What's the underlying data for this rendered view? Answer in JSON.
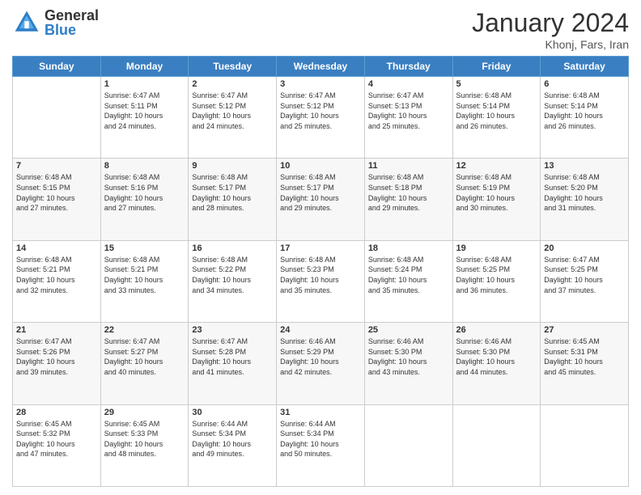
{
  "header": {
    "logo": {
      "general": "General",
      "blue": "Blue"
    },
    "title": "January 2024",
    "location": "Khonj, Fars, Iran"
  },
  "weekdays": [
    "Sunday",
    "Monday",
    "Tuesday",
    "Wednesday",
    "Thursday",
    "Friday",
    "Saturday"
  ],
  "weeks": [
    [
      {
        "day": "",
        "info": ""
      },
      {
        "day": "1",
        "info": "Sunrise: 6:47 AM\nSunset: 5:11 PM\nDaylight: 10 hours\nand 24 minutes."
      },
      {
        "day": "2",
        "info": "Sunrise: 6:47 AM\nSunset: 5:12 PM\nDaylight: 10 hours\nand 24 minutes."
      },
      {
        "day": "3",
        "info": "Sunrise: 6:47 AM\nSunset: 5:12 PM\nDaylight: 10 hours\nand 25 minutes."
      },
      {
        "day": "4",
        "info": "Sunrise: 6:47 AM\nSunset: 5:13 PM\nDaylight: 10 hours\nand 25 minutes."
      },
      {
        "day": "5",
        "info": "Sunrise: 6:48 AM\nSunset: 5:14 PM\nDaylight: 10 hours\nand 26 minutes."
      },
      {
        "day": "6",
        "info": "Sunrise: 6:48 AM\nSunset: 5:14 PM\nDaylight: 10 hours\nand 26 minutes."
      }
    ],
    [
      {
        "day": "7",
        "info": "Sunrise: 6:48 AM\nSunset: 5:15 PM\nDaylight: 10 hours\nand 27 minutes."
      },
      {
        "day": "8",
        "info": "Sunrise: 6:48 AM\nSunset: 5:16 PM\nDaylight: 10 hours\nand 27 minutes."
      },
      {
        "day": "9",
        "info": "Sunrise: 6:48 AM\nSunset: 5:17 PM\nDaylight: 10 hours\nand 28 minutes."
      },
      {
        "day": "10",
        "info": "Sunrise: 6:48 AM\nSunset: 5:17 PM\nDaylight: 10 hours\nand 29 minutes."
      },
      {
        "day": "11",
        "info": "Sunrise: 6:48 AM\nSunset: 5:18 PM\nDaylight: 10 hours\nand 29 minutes."
      },
      {
        "day": "12",
        "info": "Sunrise: 6:48 AM\nSunset: 5:19 PM\nDaylight: 10 hours\nand 30 minutes."
      },
      {
        "day": "13",
        "info": "Sunrise: 6:48 AM\nSunset: 5:20 PM\nDaylight: 10 hours\nand 31 minutes."
      }
    ],
    [
      {
        "day": "14",
        "info": "Sunrise: 6:48 AM\nSunset: 5:21 PM\nDaylight: 10 hours\nand 32 minutes."
      },
      {
        "day": "15",
        "info": "Sunrise: 6:48 AM\nSunset: 5:21 PM\nDaylight: 10 hours\nand 33 minutes."
      },
      {
        "day": "16",
        "info": "Sunrise: 6:48 AM\nSunset: 5:22 PM\nDaylight: 10 hours\nand 34 minutes."
      },
      {
        "day": "17",
        "info": "Sunrise: 6:48 AM\nSunset: 5:23 PM\nDaylight: 10 hours\nand 35 minutes."
      },
      {
        "day": "18",
        "info": "Sunrise: 6:48 AM\nSunset: 5:24 PM\nDaylight: 10 hours\nand 35 minutes."
      },
      {
        "day": "19",
        "info": "Sunrise: 6:48 AM\nSunset: 5:25 PM\nDaylight: 10 hours\nand 36 minutes."
      },
      {
        "day": "20",
        "info": "Sunrise: 6:47 AM\nSunset: 5:25 PM\nDaylight: 10 hours\nand 37 minutes."
      }
    ],
    [
      {
        "day": "21",
        "info": "Sunrise: 6:47 AM\nSunset: 5:26 PM\nDaylight: 10 hours\nand 39 minutes."
      },
      {
        "day": "22",
        "info": "Sunrise: 6:47 AM\nSunset: 5:27 PM\nDaylight: 10 hours\nand 40 minutes."
      },
      {
        "day": "23",
        "info": "Sunrise: 6:47 AM\nSunset: 5:28 PM\nDaylight: 10 hours\nand 41 minutes."
      },
      {
        "day": "24",
        "info": "Sunrise: 6:46 AM\nSunset: 5:29 PM\nDaylight: 10 hours\nand 42 minutes."
      },
      {
        "day": "25",
        "info": "Sunrise: 6:46 AM\nSunset: 5:30 PM\nDaylight: 10 hours\nand 43 minutes."
      },
      {
        "day": "26",
        "info": "Sunrise: 6:46 AM\nSunset: 5:30 PM\nDaylight: 10 hours\nand 44 minutes."
      },
      {
        "day": "27",
        "info": "Sunrise: 6:45 AM\nSunset: 5:31 PM\nDaylight: 10 hours\nand 45 minutes."
      }
    ],
    [
      {
        "day": "28",
        "info": "Sunrise: 6:45 AM\nSunset: 5:32 PM\nDaylight: 10 hours\nand 47 minutes."
      },
      {
        "day": "29",
        "info": "Sunrise: 6:45 AM\nSunset: 5:33 PM\nDaylight: 10 hours\nand 48 minutes."
      },
      {
        "day": "30",
        "info": "Sunrise: 6:44 AM\nSunset: 5:34 PM\nDaylight: 10 hours\nand 49 minutes."
      },
      {
        "day": "31",
        "info": "Sunrise: 6:44 AM\nSunset: 5:34 PM\nDaylight: 10 hours\nand 50 minutes."
      },
      {
        "day": "",
        "info": ""
      },
      {
        "day": "",
        "info": ""
      },
      {
        "day": "",
        "info": ""
      }
    ]
  ]
}
